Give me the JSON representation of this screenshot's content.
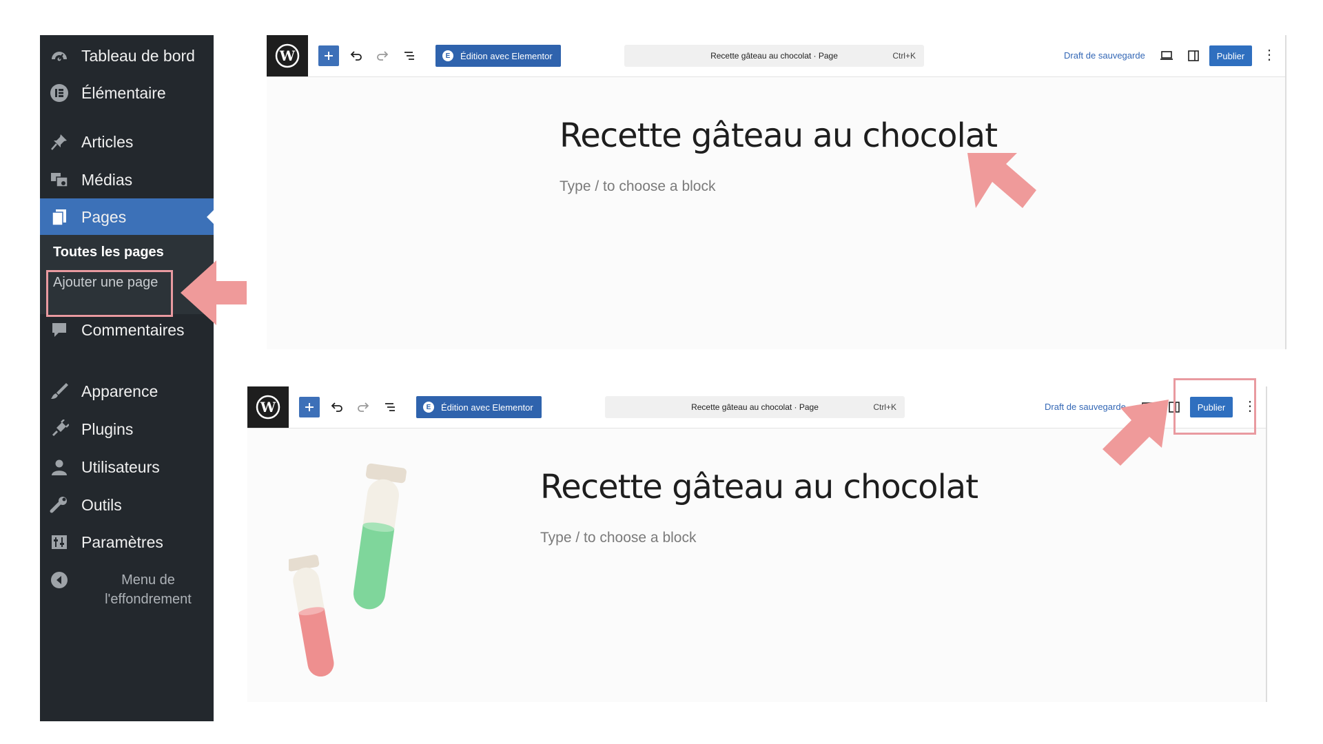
{
  "sidebar": {
    "items": [
      {
        "label": "Tableau de bord",
        "icon": "dashboard-icon"
      },
      {
        "label": "Élémentaire",
        "icon": "elementor-icon"
      },
      {
        "label": "Articles",
        "icon": "pin-icon"
      },
      {
        "label": "Médias",
        "icon": "media-icon"
      },
      {
        "label": "Pages",
        "icon": "pages-icon"
      },
      {
        "label": "Commentaires",
        "icon": "comment-icon"
      },
      {
        "label": "Apparence",
        "icon": "brush-icon"
      },
      {
        "label": "Plugins",
        "icon": "plugin-icon"
      },
      {
        "label": "Utilisateurs",
        "icon": "user-icon"
      },
      {
        "label": "Outils",
        "icon": "wrench-icon"
      },
      {
        "label": "Paramètres",
        "icon": "settings-icon"
      }
    ],
    "submenu": {
      "current": "Toutes les pages",
      "add": "Ajouter une page"
    },
    "collapse_label": "Menu de l'effondrement"
  },
  "editor": {
    "elementor_button": "Édition avec Elementor",
    "command_bar": "Recette gâteau au chocolat · Page",
    "shortcut": "Ctrl+K",
    "draft_link": "Draft de sauvegarde",
    "publish_button": "Publier",
    "page_title": "Recette gâteau au chocolat",
    "block_hint": "Type / to choose a block"
  },
  "colors": {
    "sidebar_bg": "#23282d",
    "active_item": "#3c71b8",
    "accent_blue": "#2f6fbf",
    "annotation_pink": "#ef9a9a"
  }
}
